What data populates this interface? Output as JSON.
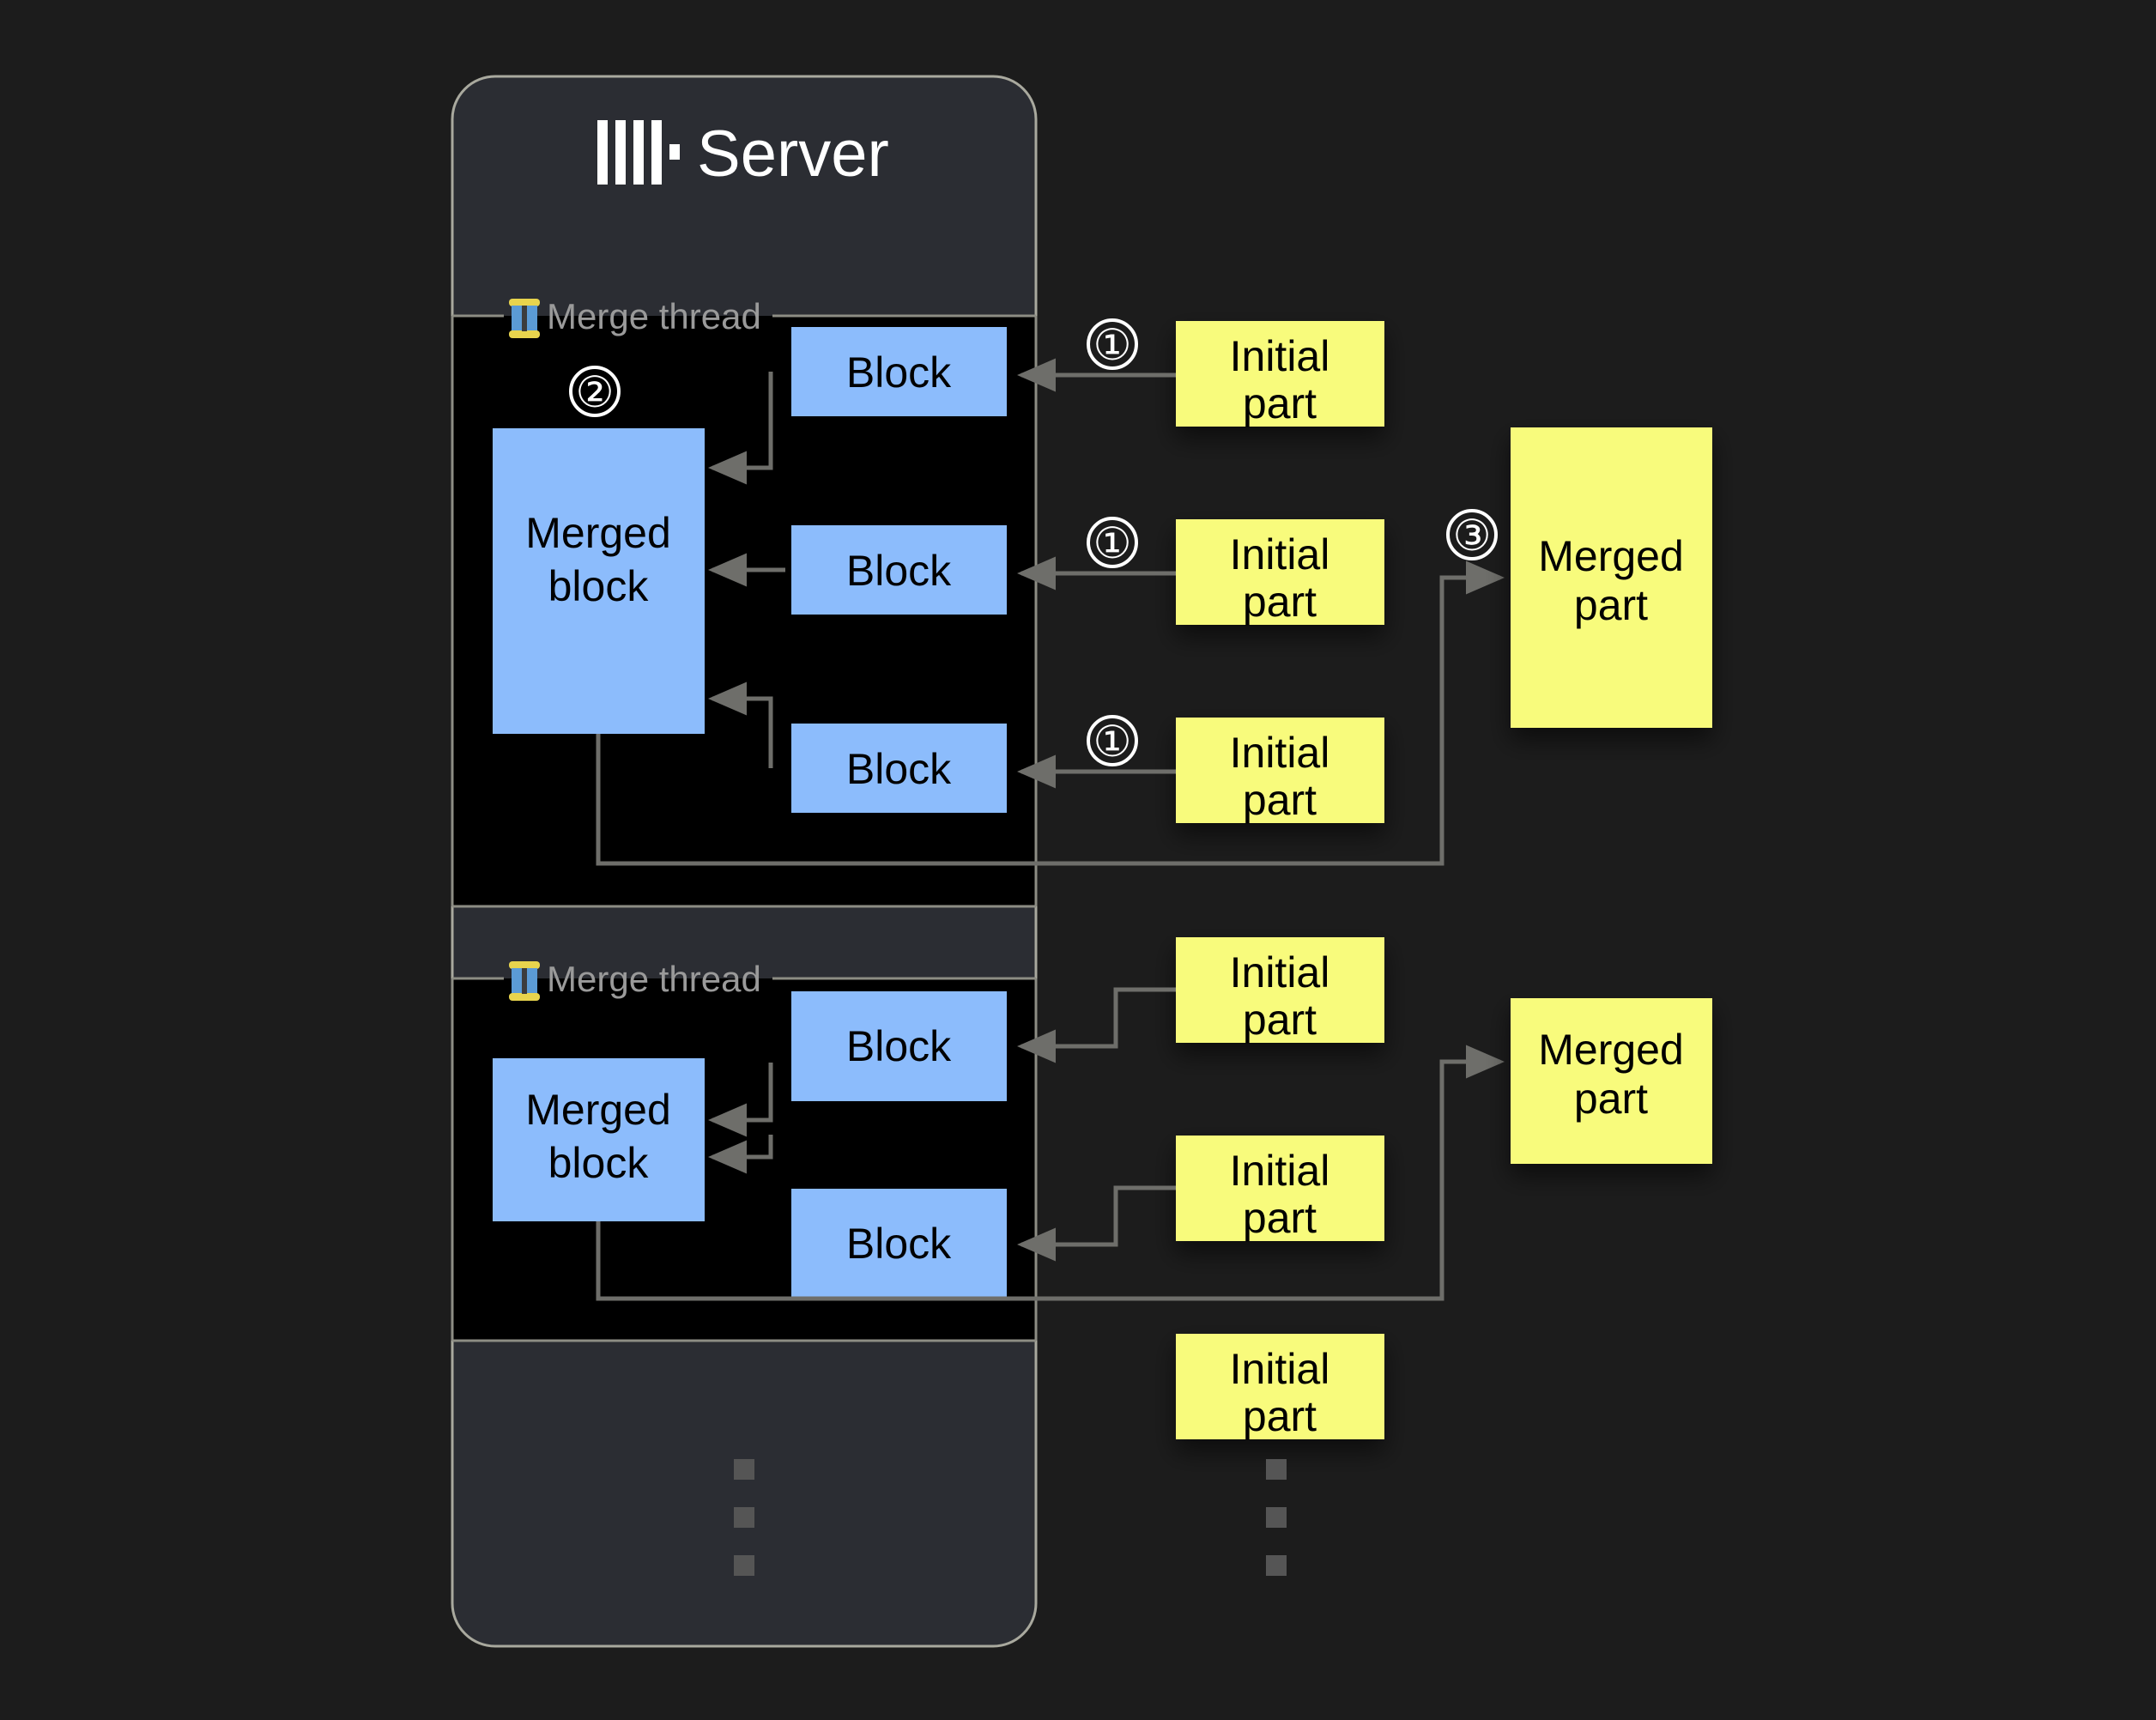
{
  "page": {
    "background_color": "#1c1c1c",
    "title": "ClickHouse Server merge thread diagram"
  },
  "server_panel": {
    "title": "Server",
    "logo_icon": "clickhouse-logo-icon",
    "background_color": "#2b2d33",
    "border_color": "#a9a99e"
  },
  "colors": {
    "block_blue": "#8cbcfc",
    "part_yellow": "#f8fb7c",
    "arrow_gray": "#6e6e6a",
    "thread_border": "#8d8d84",
    "thread_fill": "#000000",
    "ellipsis_gray": "#555555"
  },
  "threads": [
    {
      "label": "Merge thread",
      "icon": "thread-spool-icon",
      "merged_block_label": "Merged block",
      "blocks": [
        {
          "label": "Block"
        },
        {
          "label": "Block"
        },
        {
          "label": "Block"
        }
      ],
      "initial_parts": [
        {
          "label": "Initial part",
          "step": "①"
        },
        {
          "label": "Initial part",
          "step": "①"
        },
        {
          "label": "Initial part",
          "step": "①"
        }
      ],
      "merged_part": {
        "label": "Merged part",
        "step": "③"
      },
      "merge_step": "②"
    },
    {
      "label": "Merge thread",
      "icon": "thread-spool-icon",
      "merged_block_label": "Merged block",
      "blocks": [
        {
          "label": "Block"
        },
        {
          "label": "Block"
        }
      ],
      "initial_parts": [
        {
          "label": "Initial part",
          "step": ""
        },
        {
          "label": "Initial part",
          "step": ""
        }
      ],
      "merged_part": {
        "label": "Merged part",
        "step": ""
      },
      "merge_step": ""
    }
  ],
  "extra_initial_part": {
    "label": "Initial part"
  },
  "ellipsis": {
    "left": "vertical-ellipsis",
    "right": "vertical-ellipsis",
    "dot_count": 3
  },
  "labels": {
    "merged_block_line1": "Merged",
    "merged_block_line2": "block",
    "initial_line1": "Initial",
    "initial_line2": "part",
    "merged_part_line1": "Merged",
    "merged_part_line2": "part",
    "block": "Block",
    "merge_thread": "Merge thread",
    "server": "Server",
    "step_1": "①",
    "step_2": "②",
    "step_3": "③"
  }
}
